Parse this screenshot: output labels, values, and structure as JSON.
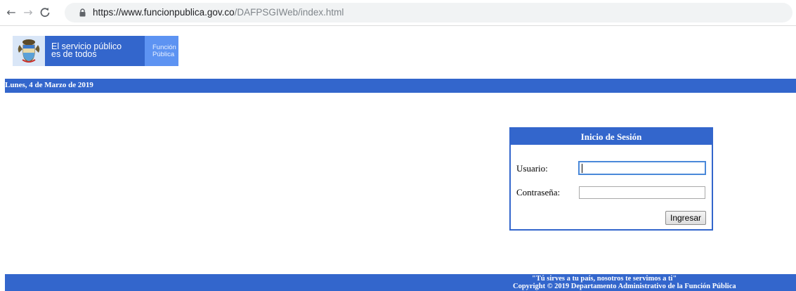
{
  "browser": {
    "url_host": "https://www.funcionpublica.gov.co",
    "url_path": "/DAFPSGIWeb/index.html",
    "back_icon": "←",
    "forward_icon": "→",
    "reload_icon": "C"
  },
  "brand": {
    "line1": "El servicio público",
    "line2": "es de todos",
    "side_line1": "Función",
    "side_line2": "Pública",
    "colors": {
      "primary": "#3366cc",
      "secondary": "#5d93f2",
      "emblem_bg": "#d9e6f7"
    }
  },
  "date_bar": {
    "text": "Lunes, 4 de Marzo de 2019"
  },
  "login": {
    "title": "Inicio de Sesión",
    "user_label": "Usuario:",
    "user_value": "",
    "password_label": "Contraseña:",
    "password_value": "",
    "submit_label": "Ingresar"
  },
  "footer": {
    "motto": "\"Tú sirves a tu país, nosotros te servimos a ti\"",
    "copyright": "Copyright © 2019 Departamento Administrativo de la Función Pública"
  },
  "icons": {
    "lock": "lock-icon",
    "emblem": "coat-of-arms-icon"
  }
}
